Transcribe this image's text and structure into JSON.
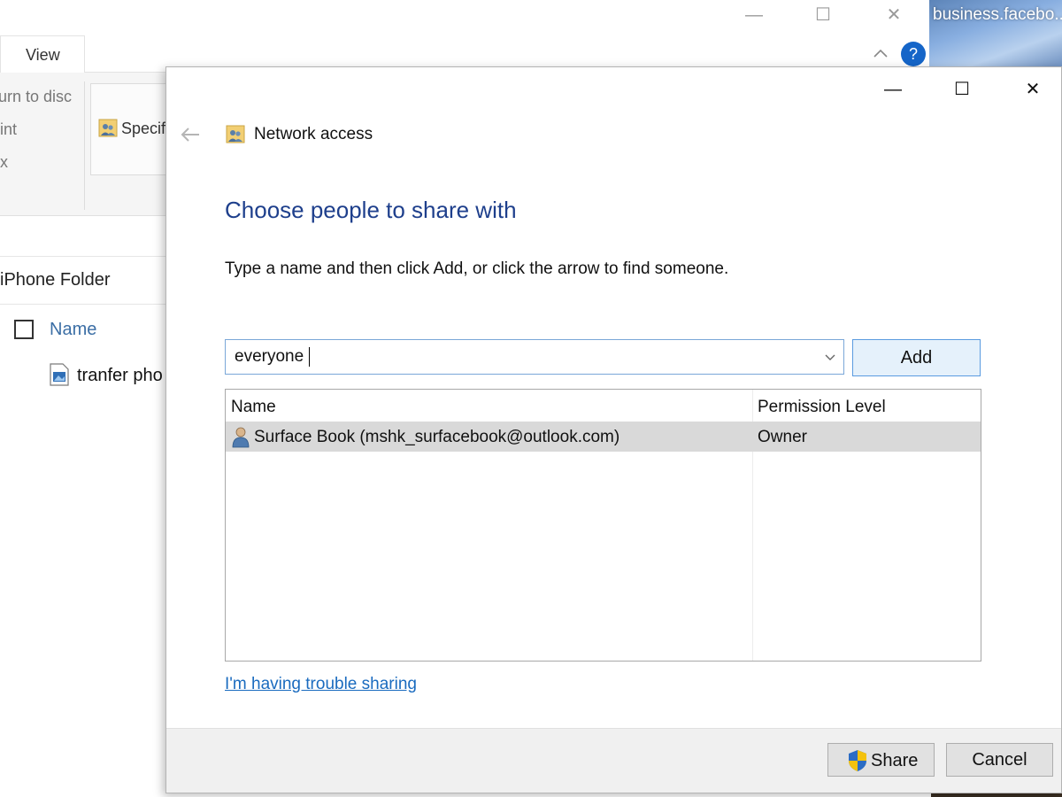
{
  "explorer": {
    "controls": {
      "minimize": "—",
      "maximize": "☐",
      "close": "✕"
    },
    "tab_label": "View",
    "help": "?",
    "ribbon": {
      "items": [
        "urn to disc",
        "int",
        "x"
      ],
      "specific_label": "Specifi"
    },
    "folder_title": "iPhone Folder",
    "column_name": "Name",
    "file_name": "tranfer pho"
  },
  "desktop": {
    "text": "business.facebo..."
  },
  "dialog": {
    "controls": {
      "minimize": "—",
      "maximize": "☐",
      "close": "✕"
    },
    "header_title": "Network access",
    "heading": "Choose people to share with",
    "instruction": "Type a name and then click Add, or click the arrow to find someone.",
    "name_input": {
      "value": "everyone"
    },
    "add_label": "Add",
    "list": {
      "columns": [
        "Name",
        "Permission Level"
      ],
      "rows": [
        {
          "name": "Surface Book (mshk_surfacebook@outlook.com)",
          "permission": "Owner"
        }
      ]
    },
    "trouble_link": "I'm having trouble sharing",
    "share_label": "Share",
    "cancel_label": "Cancel"
  },
  "colors": {
    "heading": "#1e3f8c",
    "link": "#1a6bbf",
    "accent_border": "#5a9be0",
    "selected_row": "#d9d9d9"
  }
}
